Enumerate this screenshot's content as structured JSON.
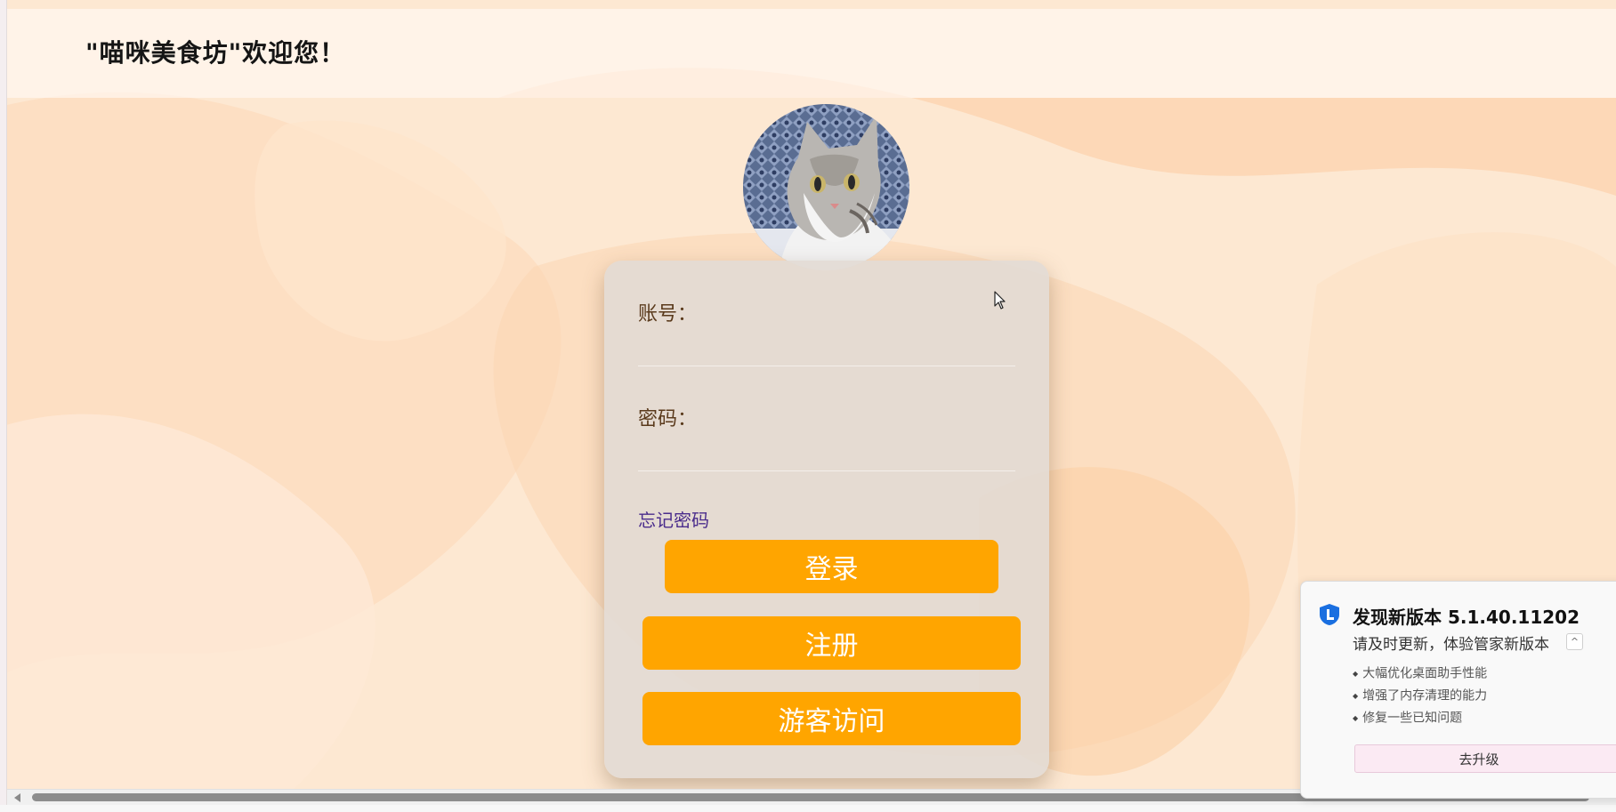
{
  "header": {
    "title": "\"喵咪美食坊\"欢迎您！"
  },
  "login": {
    "account_label": "账号：",
    "account_value": "",
    "password_label": "密码：",
    "password_value": "",
    "forgot_label": "忘记密码",
    "login_button": "登录",
    "register_button": "注册",
    "guest_button": "游客访问",
    "button_color": "#ffa500"
  },
  "notification": {
    "title": "发现新版本 5.1.40.11202",
    "subtitle": "请及时更新，体验管家新版本",
    "items": [
      "大幅优化桌面助手性能",
      "增强了内存清理的能力",
      "修复一些已知问题"
    ],
    "upgrade_button": "去升级"
  },
  "colors": {
    "background": "#fde6cc",
    "accent": "#ffa500",
    "link": "#4a2c8c"
  },
  "icons": {
    "avatar": "cat-photo",
    "cursor": "mouse-pointer-icon",
    "notify_logo": "shield-logo-icon"
  }
}
